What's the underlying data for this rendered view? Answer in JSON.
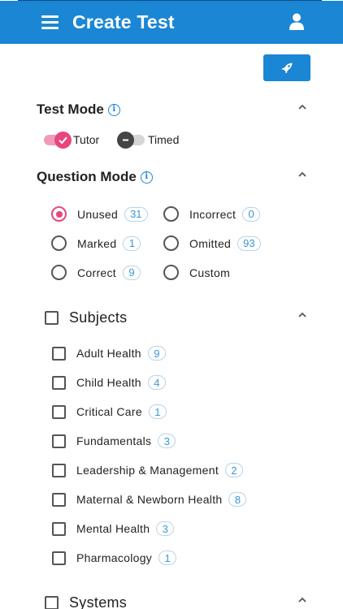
{
  "header": {
    "title": "Create Test",
    "menu_icon": "hamburger-menu-icon",
    "user_icon": "user-icon",
    "bg_color": "#1b86d3"
  },
  "launch_button": {
    "icon": "rocket-icon"
  },
  "test_mode": {
    "title": "Test Mode",
    "tutor": {
      "label": "Tutor",
      "on": true
    },
    "timed": {
      "label": "Timed",
      "on": false
    }
  },
  "question_mode": {
    "title": "Question Mode",
    "options": [
      {
        "label": "Unused",
        "count": "31",
        "selected": true
      },
      {
        "label": "Incorrect",
        "count": "0",
        "selected": false
      },
      {
        "label": "Marked",
        "count": "1",
        "selected": false
      },
      {
        "label": "Omitted",
        "count": "93",
        "selected": false
      },
      {
        "label": "Correct",
        "count": "9",
        "selected": false
      },
      {
        "label": "Custom",
        "count": "",
        "selected": false
      }
    ]
  },
  "subjects": {
    "title": "Subjects",
    "items": [
      {
        "label": "Adult Health",
        "count": "9"
      },
      {
        "label": "Child Health",
        "count": "4"
      },
      {
        "label": "Critical Care",
        "count": "1"
      },
      {
        "label": "Fundamentals",
        "count": "3"
      },
      {
        "label": "Leadership & Management",
        "count": "2"
      },
      {
        "label": "Maternal & Newborn Health",
        "count": "8"
      },
      {
        "label": "Mental Health",
        "count": "3"
      },
      {
        "label": "Pharmacology",
        "count": "1"
      }
    ]
  },
  "systems": {
    "title": "Systems"
  },
  "colors": {
    "accent": "#1b86d3",
    "toggle_on": "#e8457f",
    "badge_text": "#3a97d6"
  }
}
